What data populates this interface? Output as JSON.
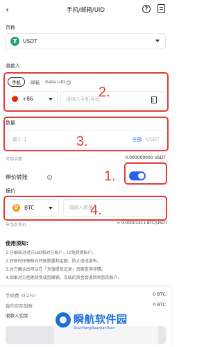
{
  "header": {
    "title": "手机/邮箱/UID",
    "back_icon": "back-arrow-icon",
    "help_icon": "?"
  },
  "coin": {
    "label": "币种",
    "symbol": "₮",
    "name": "USDT"
  },
  "recipient": {
    "label": "收款人",
    "tabs": [
      "手机",
      "邮箱",
      "Gate UID"
    ],
    "info_icon": "i",
    "country_code": "+86",
    "phone_placeholder": "请输入手机号码"
  },
  "amount": {
    "label": "数量",
    "placeholder": "最少 1",
    "all": "全部",
    "sep": "|",
    "unit": "USDT"
  },
  "available": {
    "label": "可用余额",
    "value": "0.000000000 USDT"
  },
  "paid_transfer": {
    "label": "带价转账",
    "info_icon": "i",
    "enabled": true
  },
  "price": {
    "label": "报价",
    "symbol": "₿",
    "coin": "BTC",
    "placeholder": "请输入数量"
  },
  "rate": {
    "label": "市场参考价",
    "value": "≈ 0.00001411 BTC/USDT"
  },
  "notes": {
    "title": "使用须知:",
    "lines": [
      "1.仔细核对对方UID和对方账户，以免转错账户。",
      "2.转账时仔细核对转账数量和金额，防止造成损失。",
      "3.对方确认后可以在「充值提现记录」页面查询详情。",
      "4.如果对方拒绝接受或您撤销，冻结的资金会退回到您的账户。"
    ]
  },
  "fees": [
    {
      "label": "手续费 (0.2%)",
      "value": "0 BTC"
    },
    {
      "label": "我的实际到账",
      "value": "0 BTC"
    }
  ],
  "receive": {
    "label": "收款人实际"
  },
  "annotations": [
    "1.",
    "2.",
    "3.",
    "4."
  ],
  "colors": {
    "accent": "#2563eb",
    "annotation": "#e53935",
    "usdt": "#26a17b",
    "btc": "#f7931a"
  },
  "watermark": {
    "title": "瞬航软件园",
    "subtitle": "ShunHangRuanJianYuan"
  }
}
